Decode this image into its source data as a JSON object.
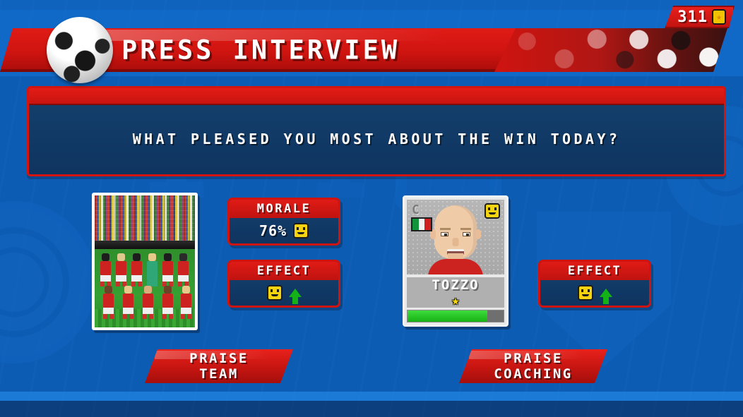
{
  "header": {
    "title": "PRESS INTERVIEW",
    "ball_icon": "soccer-ball-icon"
  },
  "currency": {
    "amount": "311",
    "coin_icon": "coin-icon"
  },
  "question": {
    "text": "WHAT PLEASED YOU MOST ABOUT THE WIN TODAY?"
  },
  "team_photo": {
    "alt": "team-squad-photo"
  },
  "morale": {
    "label": "MORALE",
    "value": "76%",
    "mood_icon": "smiley-face-icon"
  },
  "effect_team": {
    "label": "EFFECT",
    "mood_icon": "smiley-face-icon",
    "trend_icon": "green-up-arrow-icon"
  },
  "effect_coaching": {
    "label": "EFFECT",
    "mood_icon": "smiley-face-icon",
    "trend_icon": "green-up-arrow-icon"
  },
  "player_card": {
    "captain_mark": "C",
    "nationality": "italy-flag-icon",
    "mood_icon": "smiley-face-icon",
    "name": "TOZZO",
    "star_icon": "star-icon",
    "condition_percent": 83
  },
  "buttons": {
    "praise_team": {
      "line1": "PRAISE",
      "line2": "TEAM"
    },
    "praise_coaching": {
      "line1": "PRAISE",
      "line2": "COACHING"
    }
  },
  "colors": {
    "red": "#cf1410",
    "blue": "#0d5cb4",
    "panel_navy": "#0f3460",
    "green": "#17b215",
    "yellow": "#f4d311"
  }
}
